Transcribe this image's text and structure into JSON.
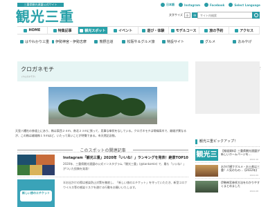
{
  "header": {
    "logo_sub": "三重県観光連盟公式サイト",
    "logo": "観光三重",
    "links": [
      "日本語",
      "Instagram",
      "Facebook",
      "Select Language"
    ],
    "font_size_label": "文字サイズ",
    "font_sizes": [
      "小",
      "中",
      "大"
    ],
    "search_placeholder": "サイト内検索"
  },
  "nav_main": [
    {
      "label": "HOME",
      "icon": "home-icon",
      "active": false
    },
    {
      "label": "特集記事",
      "icon": "book-icon",
      "active": false
    },
    {
      "label": "観光スポット",
      "icon": "camera-icon",
      "active": true
    },
    {
      "label": "イベント",
      "icon": "flag-icon",
      "active": false
    },
    {
      "label": "遊び・体験",
      "icon": "boat-icon",
      "active": false
    },
    {
      "label": "モデルコース",
      "icon": "route-icon",
      "active": false
    },
    {
      "label": "旅の予約",
      "icon": "suitcase-icon",
      "active": false
    },
    {
      "label": "アクセス",
      "icon": "train-icon",
      "active": false
    }
  ],
  "nav_sub": [
    {
      "label": "はやわかり三重",
      "icon": "map-icon"
    },
    {
      "label": "伊勢神宮・伊勢志摩",
      "icon": "shrine-icon"
    },
    {
      "label": "熊野古道",
      "icon": "trail-icon"
    },
    {
      "label": "松阪牛＆グルメ旅",
      "icon": "beef-icon"
    },
    {
      "label": "特設サイト",
      "icon": "star-icon"
    },
    {
      "label": "グルメ",
      "icon": "food-icon"
    },
    {
      "label": "おみやげ",
      "icon": "gift-icon"
    }
  ],
  "page": {
    "title": "クロガネモチ",
    "title_sub": "(クロガネモチ)",
    "breadcrumb": "〉 パキー県抜けについて",
    "description": "天皇八幡社の参道上にあり、株は東西２４ｍ、南北２３ｍに張って、見事な傘状をなしている。クロガネモチは常緑高木で、雌雄が異なるが、この株は雌雄株１５ｍほど、いたって高いことが特徴である。市天然記念物。"
  },
  "related": {
    "heading": "このスポットの関連記事",
    "articles": [
      {
        "title": "Instagram「観光三重」2020年「いいね！」ランキングを発表！絶景TOP10！",
        "text": "2020年、三重県観光連盟の公式インスタグラム「観光三重」(@kankomie) で、最も「いいね！」がついた投稿を発表！"
      },
      {
        "title": "",
        "text": "半お出かけの際は感染防止対策を徹底し、「新しい旅のエチケット」を守っていただき、新型コロナウイルス等の感染リスクを避ける行動をお願いいたします。"
      }
    ],
    "thumb_label": "新しい旅のエチケット"
  },
  "sidebar": {
    "pickup_heading": "観光三重ピックアップ！",
    "items": [
      {
        "text": "【報道資料】三重県観光連盟が新しいホームページを…",
        "date": "2022.10"
      },
      {
        "text": "おかげ横丁グルメ・お土産は三重！人気のもの…【2022年】",
        "date": "2022.09"
      },
      {
        "text": "伊勢神宮参拝方法をわかりやすくまとめました",
        "date": "2022.08"
      }
    ]
  },
  "colors": {
    "accent": "#28a1a9",
    "title_bg": "#e6f5f4"
  }
}
